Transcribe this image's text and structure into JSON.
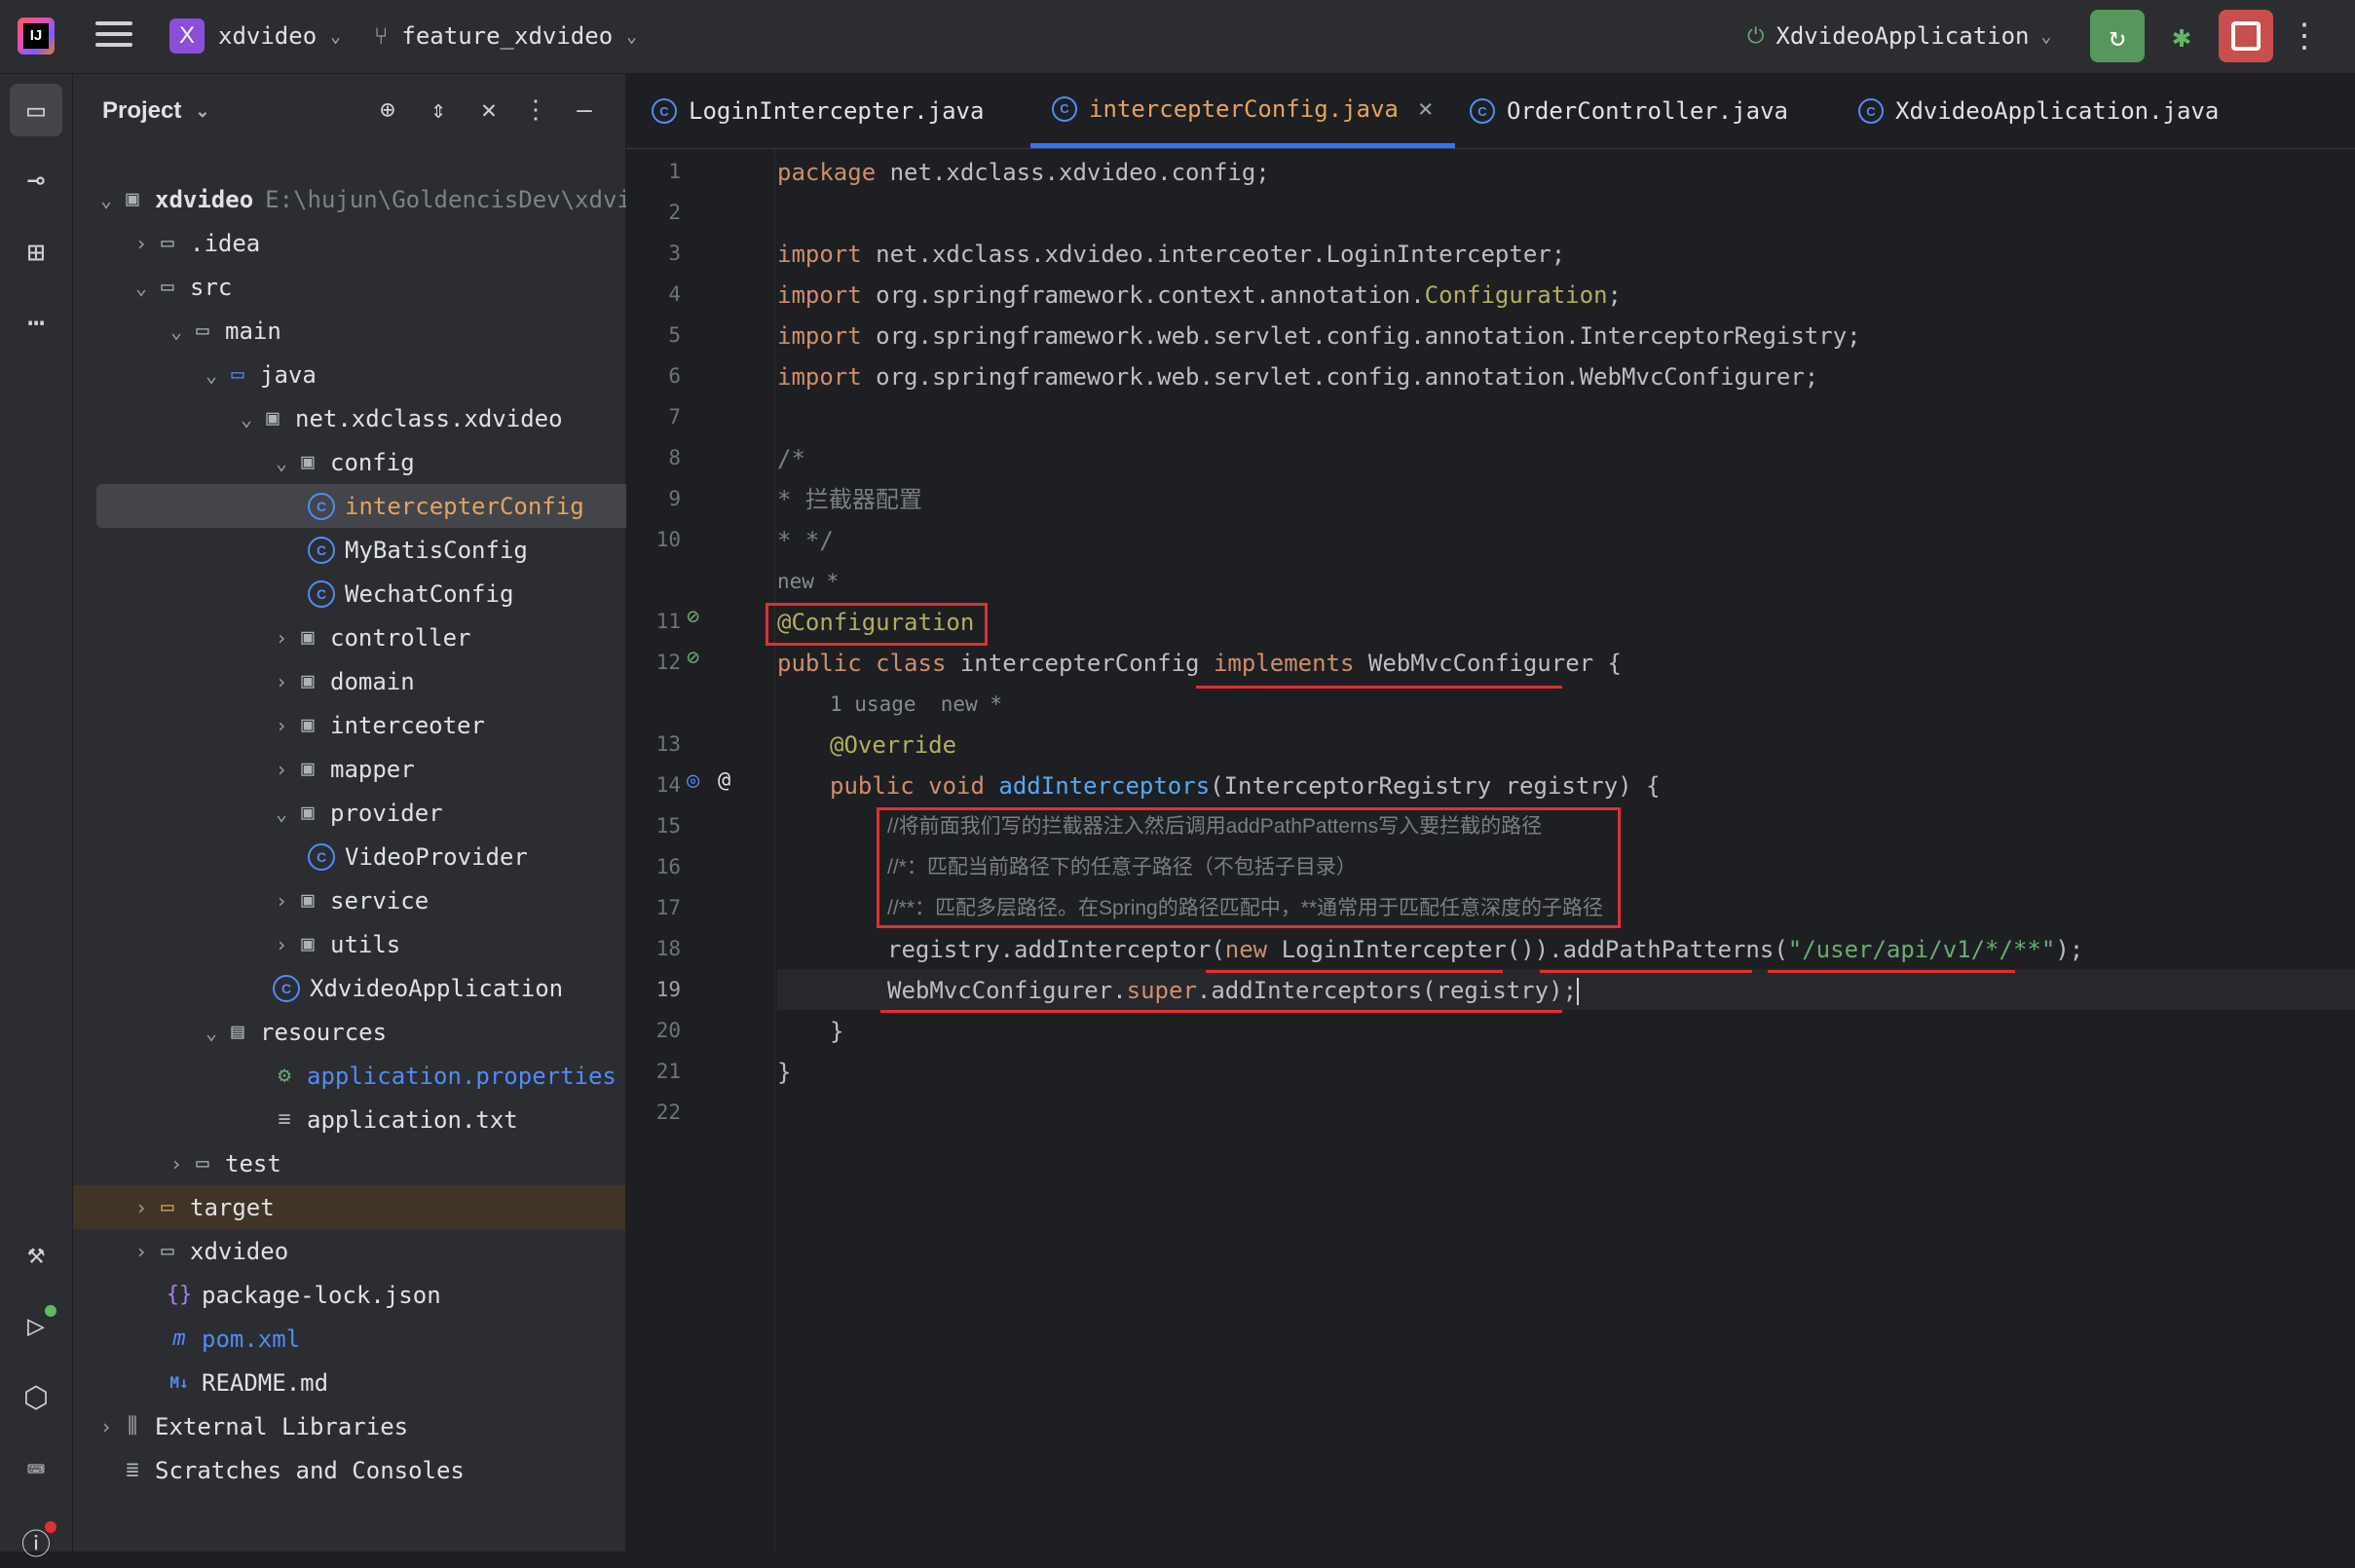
{
  "topbar": {
    "logo": "IJ",
    "project_badge": "X",
    "project_name": "xdvideo",
    "branch_name": "feature_xdvideo",
    "run_config": "XdvideoApplication",
    "icons": [
      "jetbrains-logo",
      "hamburger-menu-icon",
      "git-branch-icon",
      "run-icon",
      "debug-icon",
      "stop-icon",
      "more-vertical-icon"
    ]
  },
  "toolstrip": {
    "icons": [
      "folder-icon",
      "commit-icon",
      "structure-icon",
      "more-horizontal-icon",
      "build-icon",
      "run-tool-icon",
      "services-icon",
      "terminal-icon",
      "problems-icon"
    ],
    "accent_colors": {
      "run_dot": "#5fb865",
      "problems_dot": "#e0302f"
    }
  },
  "project_panel": {
    "title": "Project",
    "header_icons": [
      "locate-icon",
      "expand-all-icon",
      "collapse-all-icon",
      "options-icon",
      "hide-icon"
    ],
    "tree": [
      {
        "label": "xdvideo",
        "extra": "E:\\hujun\\GoldencisDev\\xdvi",
        "expanded": true,
        "icon": "module-folder-icon"
      },
      {
        "label": ".idea",
        "expanded": false,
        "icon": "folder-icon"
      },
      {
        "label": "src",
        "expanded": true,
        "icon": "folder-icon"
      },
      {
        "label": "main",
        "expanded": true,
        "icon": "folder-icon"
      },
      {
        "label": "java",
        "expanded": true,
        "icon": "source-folder-icon"
      },
      {
        "label": "net.xdclass.xdvideo",
        "expanded": true,
        "icon": "package-icon"
      },
      {
        "label": "config",
        "expanded": true,
        "icon": "package-icon"
      },
      {
        "label": "intercepterConfig",
        "icon": "class-icon",
        "selected": true
      },
      {
        "label": "MyBatisConfig",
        "icon": "class-icon"
      },
      {
        "label": "WechatConfig",
        "icon": "class-icon"
      },
      {
        "label": "controller",
        "expanded": false,
        "icon": "package-icon"
      },
      {
        "label": "domain",
        "expanded": false,
        "icon": "package-icon"
      },
      {
        "label": "interceoter",
        "expanded": false,
        "icon": "package-icon"
      },
      {
        "label": "mapper",
        "expanded": false,
        "icon": "package-icon"
      },
      {
        "label": "provider",
        "expanded": true,
        "icon": "package-icon"
      },
      {
        "label": "VideoProvider",
        "icon": "class-icon"
      },
      {
        "label": "service",
        "expanded": false,
        "icon": "package-icon"
      },
      {
        "label": "utils",
        "expanded": false,
        "icon": "package-icon"
      },
      {
        "label": "XdvideoApplication",
        "icon": "spring-app-class-icon"
      },
      {
        "label": "resources",
        "expanded": true,
        "icon": "resources-folder-icon"
      },
      {
        "label": "application.properties",
        "icon": "properties-file-icon"
      },
      {
        "label": "application.txt",
        "icon": "text-file-icon"
      },
      {
        "label": "test",
        "expanded": false,
        "icon": "folder-icon"
      },
      {
        "label": "target",
        "expanded": false,
        "icon": "excluded-folder-icon"
      },
      {
        "label": "xdvideo",
        "expanded": false,
        "icon": "folder-icon"
      },
      {
        "label": "package-lock.json",
        "icon": "json-file-icon"
      },
      {
        "label": "pom.xml",
        "icon": "maven-icon"
      },
      {
        "label": "README.md",
        "icon": "markdown-icon"
      },
      {
        "label": "External Libraries",
        "expanded": false,
        "icon": "libraries-icon"
      },
      {
        "label": "Scratches and Consoles",
        "icon": "scratches-icon"
      }
    ]
  },
  "tabs": [
    {
      "label": "LoginIntercepter.java",
      "active": false
    },
    {
      "label": "intercepterConfig.java",
      "active": true,
      "close": "×"
    },
    {
      "label": "OrderController.java",
      "active": false
    },
    {
      "label": "XdvideoApplication.java",
      "active": false
    }
  ],
  "editor": {
    "line_numbers": [
      "1",
      "2",
      "3",
      "4",
      "5",
      "6",
      "7",
      "8",
      "9",
      "10",
      "11",
      "12",
      "13",
      "14",
      "15",
      "16",
      "17",
      "18",
      "19",
      "20",
      "21",
      "22"
    ],
    "current_line": "19",
    "lines": {
      "l1": {
        "kw": "package",
        "rest": " net.xdclass.xdvideo.config;"
      },
      "l3": {
        "kw": "import",
        "rest": " net.xdclass.xdvideo.interceoter.LoginIntercepter;"
      },
      "l4": {
        "kw": "import",
        "pre": " org.springframework.context.annotation.",
        "ann": "Configuration",
        "post": ";"
      },
      "l5": {
        "kw": "import",
        "rest": " org.springframework.web.servlet.config.annotation.InterceptorRegistry;"
      },
      "l6": {
        "kw": "import",
        "rest": " org.springframework.web.servlet.config.annotation.WebMvcConfigurer;"
      },
      "l8": "/*",
      "l9": "* 拦截器配置",
      "l10": "* */",
      "hint1": "new *",
      "l11": "@Configuration",
      "l12": {
        "kw1": "public",
        "kw2": "class",
        "name": " intercepterConfig ",
        "kw3": "implements",
        "rest": " WebMvcConfigurer {"
      },
      "hint2": "1 usage  new *",
      "l13": "@Override",
      "l14": {
        "kw1": "public",
        "kw2": "void",
        "fn": "addInterceptors",
        "rest": "(InterceptorRegistry registry) {"
      },
      "l15": "//将前面我们写的拦截器注入然后调用addPathPatterns写入要拦截的路径",
      "l16": "//*：匹配当前路径下的任意子路径（不包括子目录）",
      "l17": "//**：匹配多层路径。在Spring的路径匹配中，**通常用于匹配任意深度的子路径",
      "l18": {
        "pre": "registry.addInterceptor(",
        "kw": "new",
        "mid": " LoginIntercepter()).addPathPatterns(",
        "str": "\"/user/api/v1/*/**\"",
        "post": ");"
      },
      "l19": {
        "pre": "WebMvcConfigurer.",
        "kw": "super",
        "post": ".addInterceptors(registry);"
      },
      "l20": "}",
      "l21": "}"
    },
    "gutter_icons": [
      "bean-config-icon",
      "bean-icon",
      "override-method-icon",
      "at-annotation-icon"
    ],
    "highlight_color": "#e0302f"
  }
}
